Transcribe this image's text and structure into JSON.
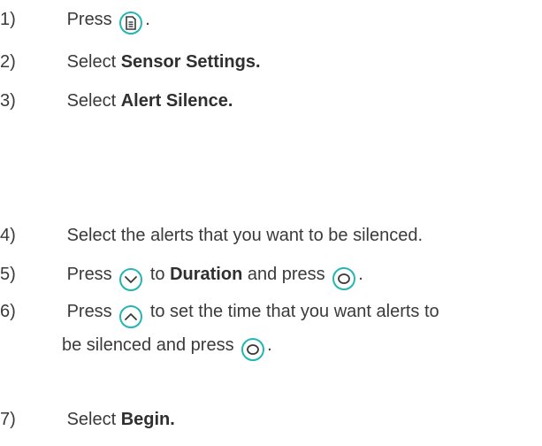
{
  "steps": [
    {
      "num": "1)",
      "pre": "Press",
      "post": "."
    },
    {
      "num": "2)",
      "pre": "Select ",
      "bold": "Sensor Settings."
    },
    {
      "num": "3)",
      "pre": "Select ",
      "bold": "Alert Silence."
    },
    {
      "num": "4)",
      "pre": "Select the alerts that you want to be silenced."
    },
    {
      "num": "5)",
      "pre": "Press",
      "mid": "to",
      "bold": "Duration",
      "post_a": "and press",
      "post": "."
    },
    {
      "num": "6)",
      "pre": "Press",
      "mid": "to set the time that you want alerts to",
      "line2": "be silenced and press",
      "post": "."
    },
    {
      "num": "7)",
      "pre": "Select ",
      "bold": "Begin."
    }
  ],
  "icons": {
    "menu": "menu-button-icon",
    "down": "down-arrow-button-icon",
    "up": "up-arrow-button-icon",
    "select": "select-button-icon"
  },
  "colors": {
    "text": "#3a3a3a",
    "icon_accent": "#25b5b4"
  }
}
